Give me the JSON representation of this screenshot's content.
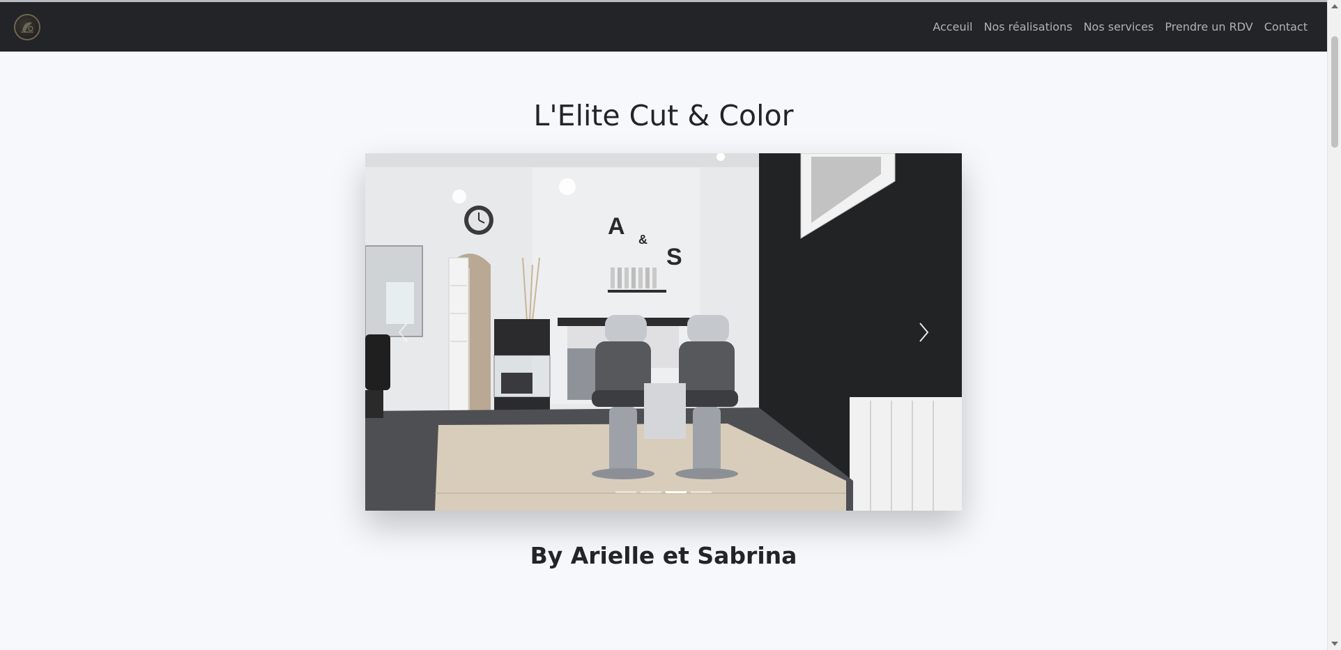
{
  "nav": {
    "items": [
      {
        "label": "Acceuil"
      },
      {
        "label": "Nos réalisations"
      },
      {
        "label": "Nos services"
      },
      {
        "label": "Prendre un RDV"
      },
      {
        "label": "Contact"
      }
    ]
  },
  "hero": {
    "title": "L'Elite Cut & Color",
    "subtitle": "By Arielle et Sabrina"
  },
  "carousel": {
    "slide_count": 4,
    "active_index": 2,
    "wall_letters": {
      "a": "A",
      "amp": "&",
      "s": "S"
    },
    "prev_icon": "chevron-left-icon",
    "next_icon": "chevron-right-icon"
  },
  "colors": {
    "navbar": "#232427",
    "page_bg": "#f7f8fb",
    "nav_link": "#aeb2b8"
  }
}
